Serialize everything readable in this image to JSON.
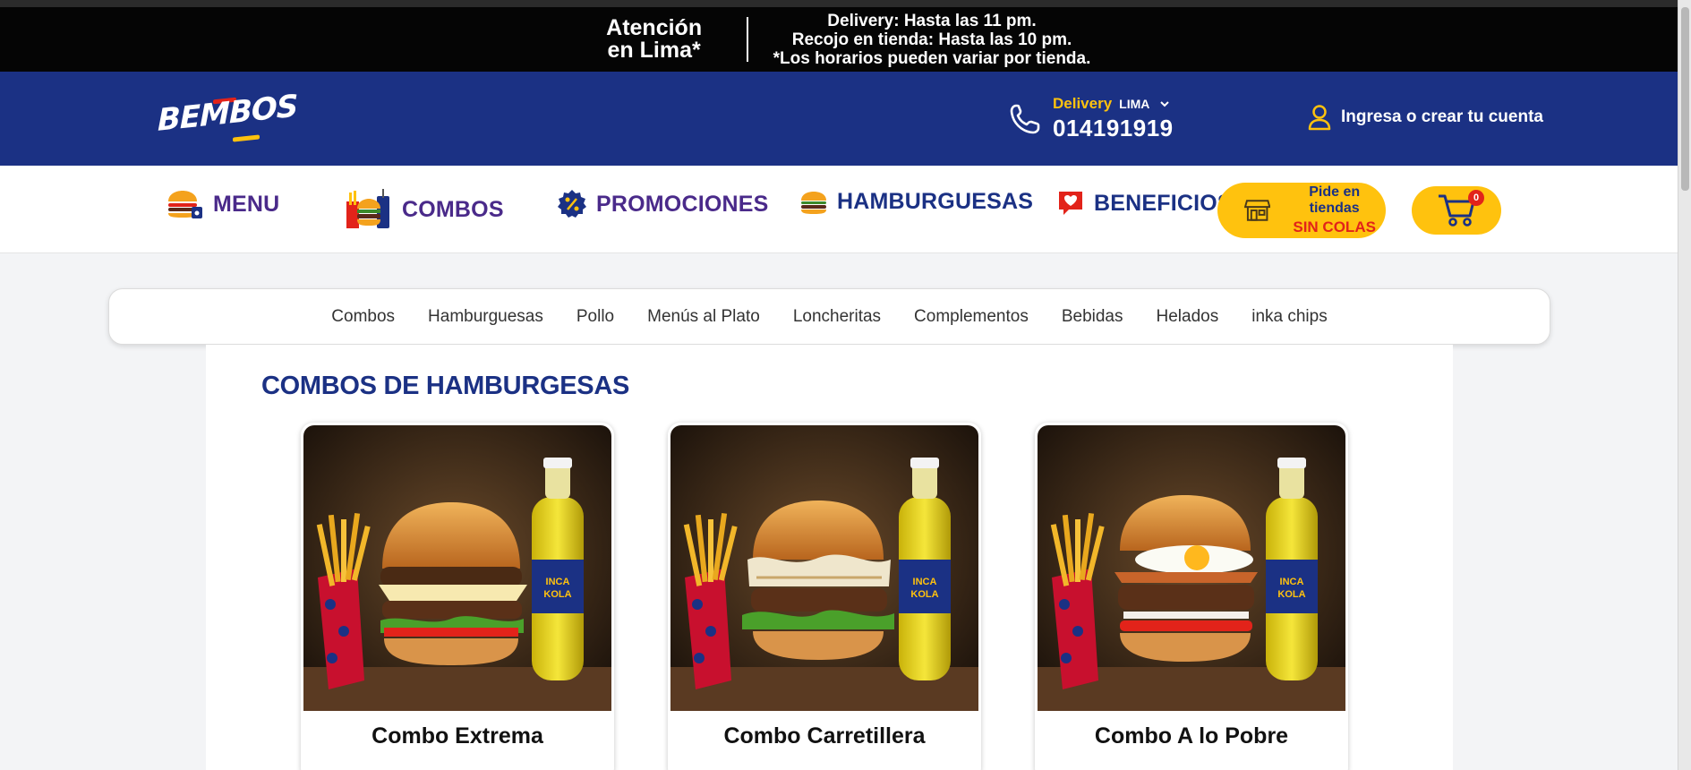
{
  "topbar": {
    "left_line1": "Atención",
    "left_line2": "en Lima*",
    "right_line1": "Delivery: Hasta las 11 pm.",
    "right_line2": "Recojo en tienda: Hasta las 10 pm.",
    "right_line3": "*Los horarios pueden variar por tienda."
  },
  "header": {
    "logo_text": "BEMBOS",
    "delivery_label": "Delivery",
    "city": "LIMA",
    "phone": "014191919",
    "account_label": "Ingresa o crear tu cuenta"
  },
  "nav": {
    "items": [
      {
        "label": "MENU",
        "icon": "burger-menu-icon"
      },
      {
        "label": "COMBOS",
        "icon": "combo-icon"
      },
      {
        "label": "PROMOCIONES",
        "icon": "percent-badge-icon"
      },
      {
        "label": "HAMBURGUESAS",
        "icon": "burger-icon"
      },
      {
        "label": "BENEFICIOS",
        "icon": "heart-badge-icon"
      }
    ],
    "stores_line1": "Pide en tiendas",
    "stores_line2": "SIN COLAS",
    "cart_count": "0"
  },
  "categories": [
    "Combos",
    "Hamburguesas",
    "Pollo",
    "Menús al Plato",
    "Loncheritas",
    "Complementos",
    "Bebidas",
    "Helados",
    "inka chips"
  ],
  "section": {
    "title": "COMBOS DE HAMBURGESAS",
    "products": [
      {
        "name": "Combo Extrema"
      },
      {
        "name": "Combo Carretillera"
      },
      {
        "name": "Combo A lo Pobre"
      }
    ]
  },
  "colors": {
    "brand_blue": "#1b3184",
    "brand_yellow": "#ffc20e",
    "brand_red": "#e2231a",
    "nav_purple": "#4a2a8a"
  }
}
